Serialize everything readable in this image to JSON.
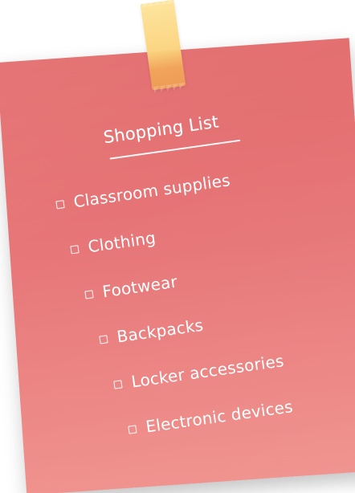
{
  "note": {
    "title": "Shopping List",
    "items": [
      {
        "label": "Classroom supplies"
      },
      {
        "label": "Clothing"
      },
      {
        "label": "Footwear"
      },
      {
        "label": "Backpacks"
      },
      {
        "label": "Locker accessories"
      },
      {
        "label": "Electronic devices"
      }
    ],
    "colors": {
      "note": "#e77678",
      "tape": "#fbd681",
      "text": "#ffffff"
    }
  }
}
